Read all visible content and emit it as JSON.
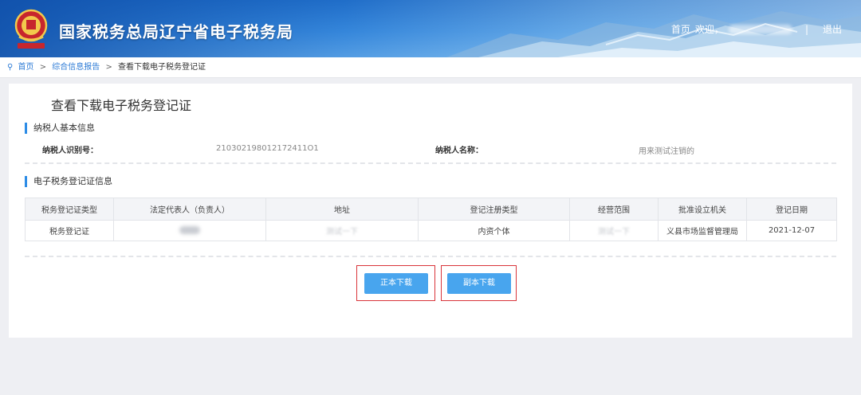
{
  "header": {
    "title": "国家税务总局辽宁省电子税务局",
    "links": {
      "home": "首页",
      "welcome": "欢迎，",
      "separator": "|",
      "logout": "退出"
    }
  },
  "breadcrumb": {
    "items": [
      "首页",
      "综合信息报告",
      "查看下载电子税务登记证"
    ],
    "separator": ">"
  },
  "page": {
    "title": "查看下载电子税务登记证"
  },
  "taxpayer_section": {
    "title": "纳税人基本信息",
    "id_label": "纳税人识别号：",
    "id_value": "210302198012172411O1",
    "name_label": "纳税人名称：",
    "name_value": "用来测试注销的"
  },
  "cert_section": {
    "title": "电子税务登记证信息",
    "columns": [
      "税务登记证类型",
      "法定代表人（负责人）",
      "地址",
      "登记注册类型",
      "经营范围",
      "批准设立机关",
      "登记日期"
    ],
    "rows": [
      {
        "type": "税务登记证",
        "address": "测试一下",
        "reg_type": "内资个体",
        "scope": "测试一下",
        "authority": "义县市场监督管理局",
        "date": "2021-12-07"
      }
    ]
  },
  "buttons": {
    "original_download": "正本下载",
    "copy_download": "副本下载"
  },
  "colors": {
    "header_blue": "#1a66c2",
    "link_blue": "#2d7bd6",
    "button_blue": "#48a5ee",
    "highlight_red": "#d9343a"
  }
}
